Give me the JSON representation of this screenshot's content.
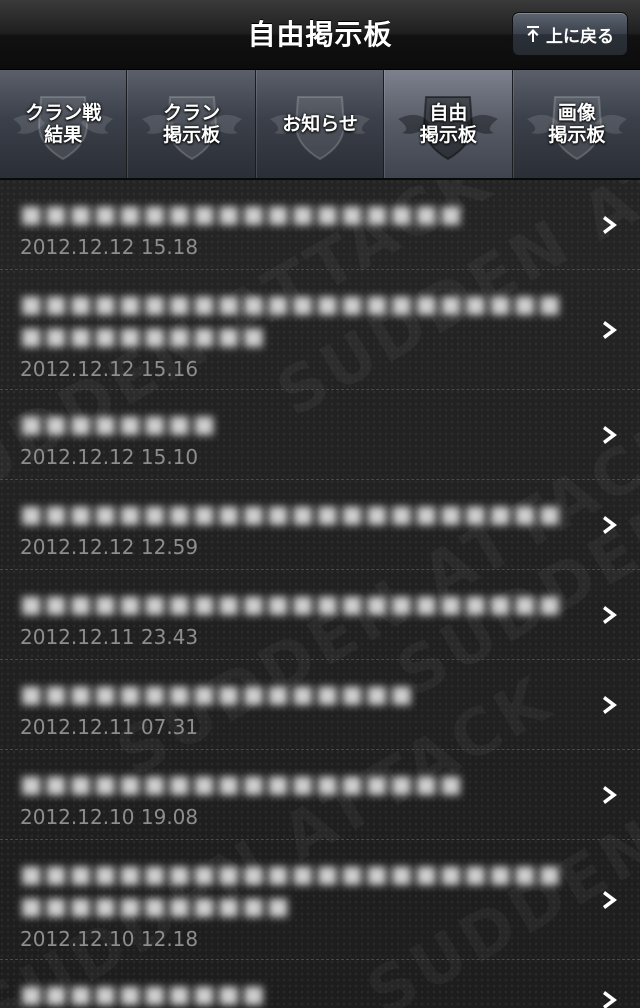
{
  "header": {
    "title": "自由掲示板",
    "back_top_label": "上に戻る"
  },
  "tabs": [
    {
      "label": "クラン戦\n結果",
      "active": false
    },
    {
      "label": "クラン\n掲示板",
      "active": false
    },
    {
      "label": "お知らせ",
      "active": false
    },
    {
      "label": "自由\n掲示板",
      "active": true
    },
    {
      "label": "画像\n掲示板",
      "active": false
    }
  ],
  "watermark_text": "SUDDEN ATTACK",
  "posts": [
    {
      "title": "■■■■■■■■■■■■■■■■■■",
      "date": "2012.12.12 15.18"
    },
    {
      "title": "■■■■■■■■■■■■■■■■■■■■■■■■■■■■■■■■",
      "date": "2012.12.12 15.16"
    },
    {
      "title": "■■■■■■■■",
      "date": "2012.12.12 15.10"
    },
    {
      "title": "■■■■■■■■■■■■■■■■■■■■■■",
      "date": "2012.12.12 12.59"
    },
    {
      "title": "■■■■■■■■■■■■■■■■■■■■■■",
      "date": "2012.12.11 23.43"
    },
    {
      "title": "■■■■■■■■■■■■■■■■",
      "date": "2012.12.11 07.31"
    },
    {
      "title": "■■■■■■■■■■■■■■■■■■",
      "date": "2012.12.10 19.08"
    },
    {
      "title": "■■■■■■■■■■■■■■■■■■■■■■■■■■■■■■■■■",
      "date": "2012.12.10 12.18"
    },
    {
      "title": "■■■■■■■■■■",
      "date": ""
    }
  ],
  "colors": {
    "accent_tab_active": "#6b707b",
    "date_text": "#8d8d8d",
    "separator": "#4a4a4a"
  }
}
